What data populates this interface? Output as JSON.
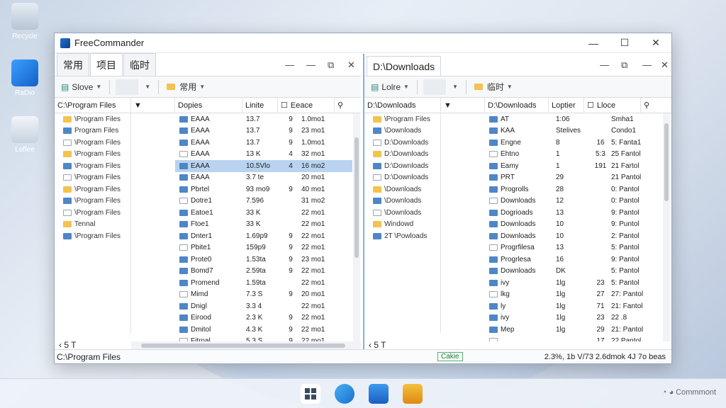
{
  "window": {
    "title": "FreeCommander"
  },
  "left": {
    "tabs": [
      "常用",
      "项目",
      "临时"
    ],
    "active_tab": 1,
    "toolbar": {
      "btn1": "Slove",
      "btn2": "常用"
    },
    "headers": {
      "tree": "C:\\Program Files",
      "name": "Dopies",
      "size": "Linite",
      "type": "Eeace"
    },
    "tree": [
      "\\Program Files",
      "Program Files",
      "\\Program Files",
      "\\Program Files",
      "\\Program Files",
      "\\Program Files",
      "\\Program Files",
      "\\Program Files",
      "\\Program Files",
      "Tennal",
      "\\Program Files"
    ],
    "rows": [
      {
        "name": "EAAA",
        "size": "13.7",
        "t": "9",
        "d": "1.0mo1"
      },
      {
        "name": "EAAA",
        "size": "13.7",
        "t": "9",
        "d": "23 mo1"
      },
      {
        "name": "EAAA",
        "size": "13.7",
        "t": "9",
        "d": "1.0mo1"
      },
      {
        "name": "EAAA",
        "size": "13 K",
        "t": "4",
        "d": "32 mo1"
      },
      {
        "name": "EAAA",
        "size": "10.5Vlo",
        "t": "4",
        "d": "16 mo2"
      },
      {
        "name": "EAAA",
        "size": "3.7 te",
        "t": "",
        "d": "20 mo1"
      },
      {
        "name": "Pbrtel",
        "size": "93 mo9",
        "t": "9",
        "d": "40 mo1"
      },
      {
        "name": "Dotre1",
        "size": "7.596",
        "t": "",
        "d": "31 mo2"
      },
      {
        "name": "Eatoe1",
        "size": "33 K",
        "t": "",
        "d": "22 mo1"
      },
      {
        "name": "Ftoe1",
        "size": "33 K",
        "t": "",
        "d": "22 mo1"
      },
      {
        "name": "Dnter1",
        "size": "1.69p9",
        "t": "9",
        "d": "22 mo1"
      },
      {
        "name": "Pbite1",
        "size": "159p9",
        "t": "9",
        "d": "22 mo1"
      },
      {
        "name": "Prote0",
        "size": "1.53ta",
        "t": "9",
        "d": "23 mo1"
      },
      {
        "name": "Bomd7",
        "size": "2.59ta",
        "t": "9",
        "d": "22 mo1"
      },
      {
        "name": "Promend",
        "size": "1.59ta",
        "t": "",
        "d": "22 mo1"
      },
      {
        "name": "Mimd",
        "size": "7.3 S",
        "t": "9",
        "d": "20 mo1"
      },
      {
        "name": "Dnigl",
        "size": "3.3 4",
        "t": "",
        "d": "22 mo1"
      },
      {
        "name": "Eirood",
        "size": "2.3 K",
        "t": "9",
        "d": "22 mo1"
      },
      {
        "name": "Dmitol",
        "size": "4.3 K",
        "t": "9",
        "d": "22 mo1"
      },
      {
        "name": "Fitrnal",
        "size": "5.3 S",
        "t": "9",
        "d": "22 mo1"
      }
    ],
    "footer": "5 T"
  },
  "right": {
    "tabs": [
      "D:\\Downloads"
    ],
    "toolbar": {
      "btn1": "Lolre",
      "btn2": "临时"
    },
    "headers": {
      "tree": "D:\\Downloads",
      "name": "D:\\Downloads",
      "size": "Loptier",
      "type": "Lloce"
    },
    "tree": [
      "\\Program Files",
      "\\Downloads",
      "D:\\Downloads",
      "D:\\Downloads",
      "D:\\Downloads",
      "D:\\Downloads",
      "\\Downloads",
      "\\Downloads",
      "\\Downloads",
      "Windowd",
      "2T \\Powloads"
    ],
    "rows": [
      {
        "name": "AT",
        "size": "1:06",
        "t": "",
        "d": "Smha1"
      },
      {
        "name": "KAA",
        "size": "Stelives",
        "t": "",
        "d": "Condo1"
      },
      {
        "name": "Engne",
        "size": "8",
        "t": "16",
        "d": "5: Fanta1"
      },
      {
        "name": "Ehtno",
        "size": "1",
        "t": "5:3",
        "d": "25 Fantol"
      },
      {
        "name": "Eamy",
        "size": "1",
        "t": "191",
        "d": "21 Fartol"
      },
      {
        "name": "PRT",
        "size": "29",
        "t": "",
        "d": "21 Pantol"
      },
      {
        "name": "Progrolls",
        "size": "28",
        "t": "",
        "d": "0: Pantol"
      },
      {
        "name": "Downloads",
        "size": "12",
        "t": "",
        "d": "0: Pantol"
      },
      {
        "name": "Dogrioads",
        "size": "13",
        "t": "",
        "d": "9: Pantol"
      },
      {
        "name": "Downloads",
        "size": "10",
        "t": "",
        "d": "9: Puntol"
      },
      {
        "name": "Downloads",
        "size": "10",
        "t": "",
        "d": "2: Pantol"
      },
      {
        "name": "Progrfilesa",
        "size": "13",
        "t": "",
        "d": "5: Pantol"
      },
      {
        "name": "Progrlesa",
        "size": "16",
        "t": "",
        "d": "9: Pantol"
      },
      {
        "name": "Downloads",
        "size": "DK",
        "t": "",
        "d": "5: Pantol"
      },
      {
        "name": "ivy",
        "size": "1lg",
        "t": "23",
        "d": "5: Pantol"
      },
      {
        "name": "lkg",
        "size": "1lg",
        "t": "27",
        "d": "27: Pantol"
      },
      {
        "name": "ly",
        "size": "1lg",
        "t": "71",
        "d": "21: Fantol"
      },
      {
        "name": "ivy",
        "size": "1lg",
        "t": "23",
        "d": "22 .8"
      },
      {
        "name": "Mep",
        "size": "1lg",
        "t": "29",
        "d": "21: Pantol"
      },
      {
        "name": "",
        "size": "",
        "t": "17",
        "d": "22 Pantol"
      }
    ],
    "footer": "5 T"
  },
  "status": {
    "path": "C:\\Program Files",
    "badge": "Cakie",
    "info": "2.3%, 1b V/73 2.6dmok 4J 7o beas"
  },
  "desktop_labels": [
    "Recycle",
    "RaDio",
    "Loffee"
  ],
  "tray": "Commmont"
}
